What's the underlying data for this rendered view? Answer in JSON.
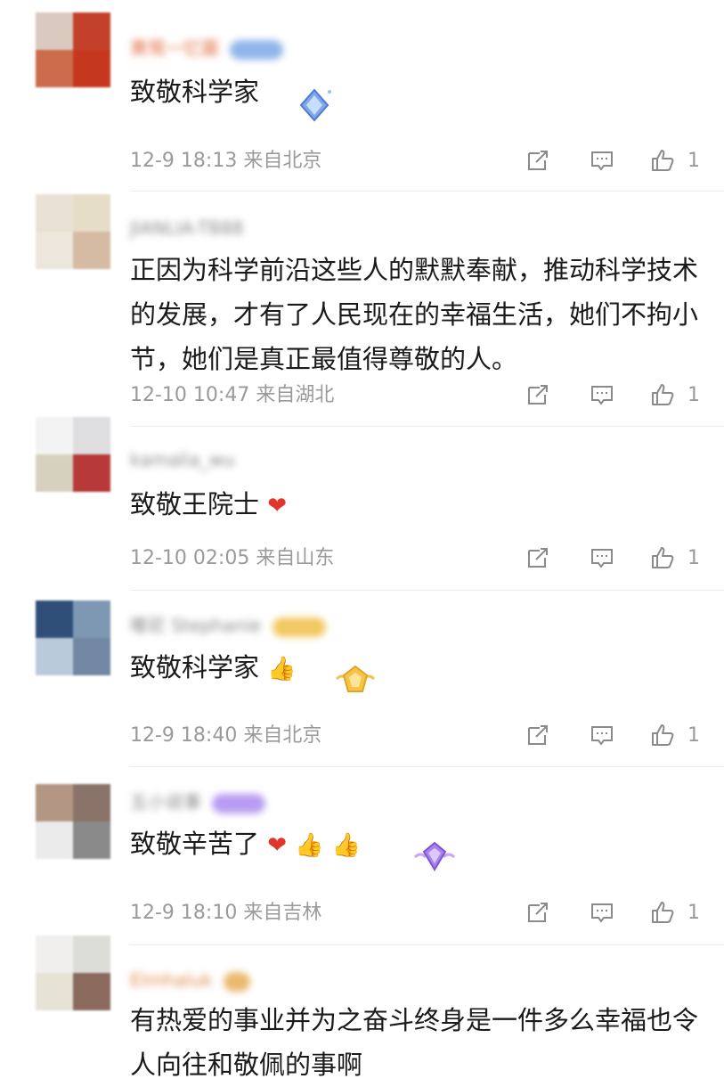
{
  "comments": [
    {
      "username": "黄鸳一忆菌",
      "text": "致敬科学家",
      "time": "12-9 18:13",
      "location": "来自北京",
      "likes": "1",
      "avatar_colors": [
        "#d9c9be",
        "#c3402a",
        "#cc6c4c",
        "#c6371f"
      ],
      "badge_color": "#8fb6ea"
    },
    {
      "username": "JIANLIA-TB88",
      "text": "正因为科学前沿这些人的默默奉献，推动科学技术的发展，才有了人民现在的幸福生活，她们不拘小节，她们是真正最值得尊敬的人。",
      "time": "12-10 10:47",
      "location": "来自湖北",
      "likes": "1",
      "avatar_colors": [
        "#e9e2d4",
        "#e5ddc7",
        "#ece6dc",
        "#d5bba4"
      ],
      "badge_color": ""
    },
    {
      "username": "kamalia_wu",
      "text": "致敬王院士",
      "time": "12-10 02:05",
      "location": "来自山东",
      "likes": "1",
      "avatar_colors": [
        "#f3f3f4",
        "#dedee0",
        "#d6d1bf",
        "#b7393a"
      ],
      "badge_color": ""
    },
    {
      "username": "嘟尼 Stephanie",
      "text": "致敬科学家",
      "time": "12-9 18:40",
      "location": "来自北京",
      "likes": "1",
      "avatar_colors": [
        "#2f4f78",
        "#7e98b3",
        "#b9cadb",
        "#7187a2"
      ],
      "badge_color": "#f2c863"
    },
    {
      "username": "五小说事",
      "text": "致敬辛苦了",
      "time": "12-9 18:10",
      "location": "来自吉林",
      "likes": "1",
      "avatar_colors": [
        "#b49684",
        "#8a7369",
        "#ebebeb",
        "#8a8a8a"
      ],
      "badge_color": "#b89cf1"
    },
    {
      "username": "Elmhaluk",
      "text": "有热爱的事业并为之奋斗终身是一件多么幸福也令人向往和敬佩的事啊",
      "avatar_colors": [
        "#f0efed",
        "#dcdcd9",
        "#e7e2d6",
        "#8a6a5c"
      ],
      "badge_color": "#e9b96f"
    }
  ],
  "icons": {
    "share": "share-icon",
    "comment": "comment-icon",
    "like": "thumbs-up-icon"
  }
}
